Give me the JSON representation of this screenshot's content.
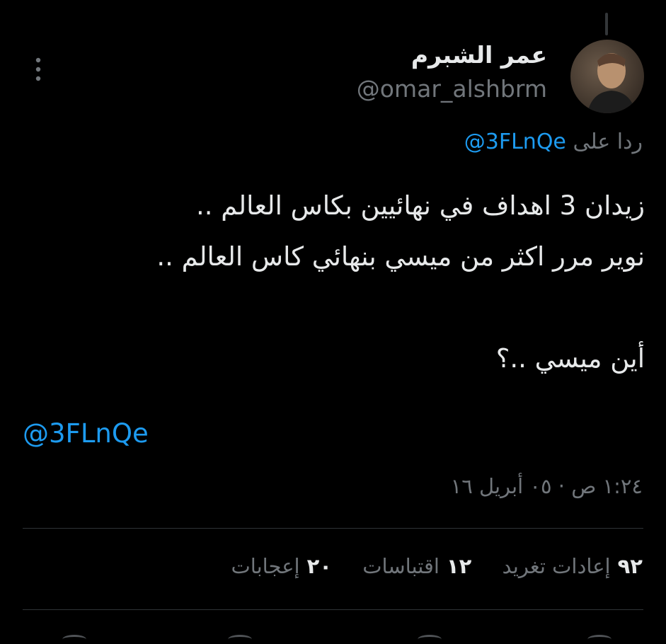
{
  "tweet": {
    "display_name": "عمر الشبرم",
    "handle": "@omar_alshbrm",
    "replying_prefix": "ردا على",
    "replying_to": "@3FLnQe",
    "lines": [
      "زيدان 3 اهداف في نهائيين بكاس العالم ..",
      "نوير مرر اكثر من ميسي بنهائي كاس العالم ..",
      "",
      "أين ميسي ..؟"
    ],
    "mention": "@3FLnQe",
    "timestamp": "١:٢٤ ص · ٠٥ أبريل ١٦"
  },
  "stats": {
    "retweets_count": "٩٢",
    "retweets_label": "إعادات تغريد",
    "quotes_count": "١٢",
    "quotes_label": "اقتباسات",
    "likes_count": "٢٠",
    "likes_label": "إعجابات"
  },
  "colors": {
    "background": "#000000",
    "text": "#e7e9ea",
    "muted": "#71767b",
    "link": "#1d9bf0",
    "divider": "#2f3336"
  },
  "icons": {
    "more": "more-vertical-icon",
    "avatar": "avatar"
  }
}
